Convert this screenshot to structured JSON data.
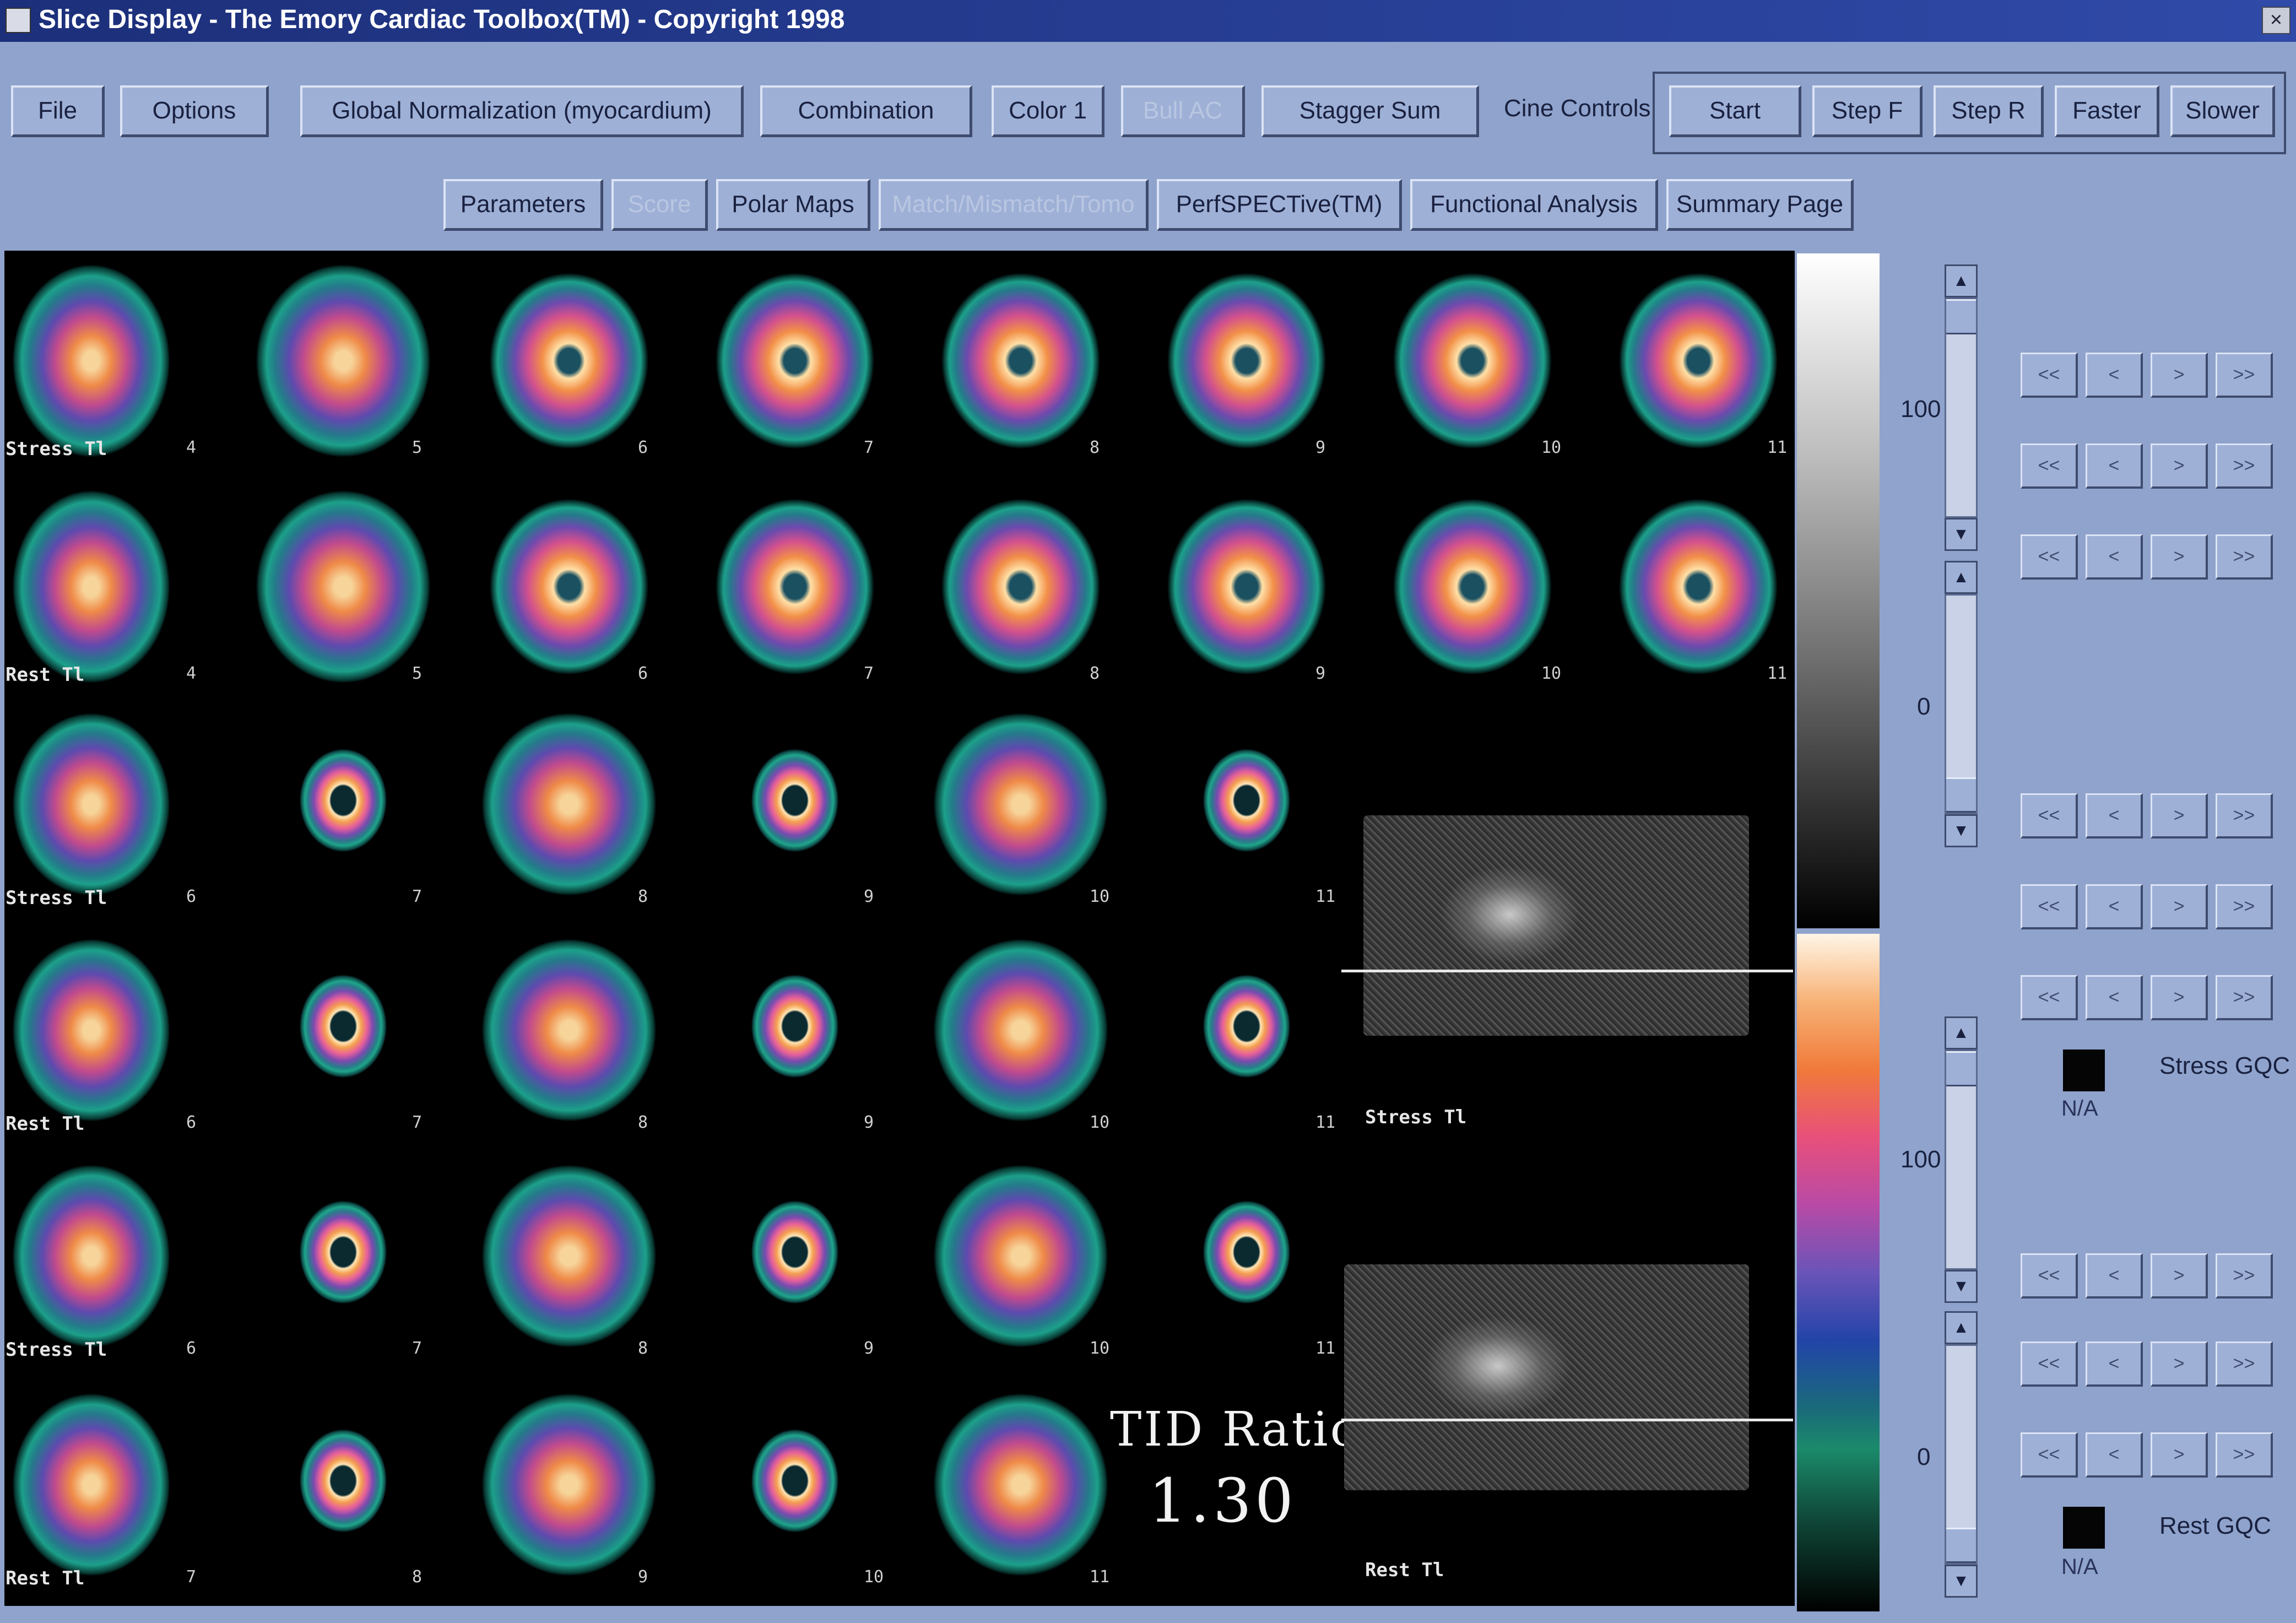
{
  "window": {
    "title": "Slice Display - The Emory Cardiac Toolbox(TM) - Copyright 1998",
    "close": "×"
  },
  "toolbar1": {
    "file": "File",
    "options": "Options",
    "global_norm": "Global Normalization (myocardium)",
    "combination": "Combination",
    "color": "Color 1",
    "disabled_btn": "Bull AC",
    "stagger": "Stagger Sum",
    "cine_label": "Cine Controls",
    "start": "Start",
    "step_f": "Step F",
    "step_r": "Step R",
    "faster": "Faster",
    "slower": "Slower"
  },
  "toolbar2": {
    "parameters": "Parameters",
    "disabled_a": "Score",
    "polar_maps": "Polar Maps",
    "disabled_b": "Match/Mismatch/Tomo",
    "perfspect": "PerfSPECTive(TM)",
    "functional": "Functional Analysis",
    "summary": "Summary Page"
  },
  "rows": [
    {
      "label": "Stress Tl",
      "numbers": [
        "4",
        "5",
        "6",
        "7",
        "8",
        "9",
        "10",
        "11"
      ]
    },
    {
      "label": "Rest Tl",
      "numbers": [
        "4",
        "5",
        "6",
        "7",
        "8",
        "9",
        "10",
        "11"
      ]
    },
    {
      "label": "Stress Tl",
      "numbers": [
        "6",
        "7",
        "8",
        "9",
        "10",
        "11"
      ]
    },
    {
      "label": "Rest Tl",
      "numbers": [
        "6",
        "7",
        "8",
        "9",
        "10",
        "11"
      ]
    },
    {
      "label": "Stress Tl",
      "numbers": [
        "6",
        "7",
        "8",
        "9",
        "10",
        "11"
      ]
    },
    {
      "label": "Rest Tl",
      "numbers": [
        "7",
        "8",
        "9",
        "10",
        "11"
      ]
    }
  ],
  "projections": {
    "stress_label": "Stress Tl",
    "rest_label": "Rest Tl"
  },
  "tid": {
    "label": "TID Ratio",
    "value": "1.30"
  },
  "scale": {
    "gray_high": "100",
    "gray_low": "0",
    "color_high": "100",
    "color_low": "0"
  },
  "nav_buttons": {
    "first": "<<",
    "prev": "<",
    "next": ">",
    "last": ">>"
  },
  "gqc": {
    "stress": "Stress GQC",
    "rest": "Rest GQC",
    "stress_na": "N/A",
    "rest_na": "N/A"
  },
  "scroll": {
    "up": "▲",
    "down": "▼"
  },
  "colors": {
    "title_bar": "#1c2f7a",
    "panel": "#8fa3cc",
    "button": "#9eb0d6"
  }
}
